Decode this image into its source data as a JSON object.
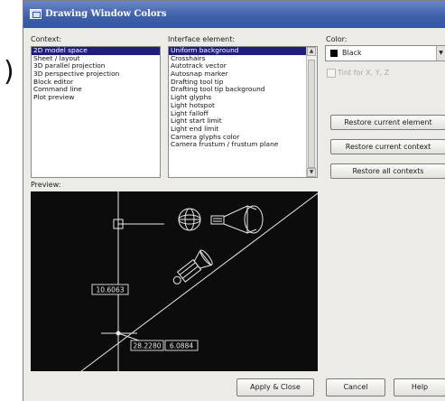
{
  "external_text": ")",
  "window": {
    "title": "Drawing Window Colors"
  },
  "context": {
    "label": "Context:",
    "items": [
      {
        "label": "2D model space",
        "selected": true
      },
      {
        "label": "Sheet / layout",
        "selected": false
      },
      {
        "label": "3D parallel projection",
        "selected": false
      },
      {
        "label": "3D perspective projection",
        "selected": false
      },
      {
        "label": "Block editor",
        "selected": false
      },
      {
        "label": "Command line",
        "selected": false
      },
      {
        "label": "Plot preview",
        "selected": false
      }
    ]
  },
  "interface": {
    "label": "Interface element:",
    "items": [
      {
        "label": "Uniform background",
        "selected": true
      },
      {
        "label": "Crosshairs",
        "selected": false
      },
      {
        "label": "Autotrack vector",
        "selected": false
      },
      {
        "label": "Autosnap marker",
        "selected": false
      },
      {
        "label": "Drafting tool tip",
        "selected": false
      },
      {
        "label": "Drafting tool tip background",
        "selected": false
      },
      {
        "label": "Light glyphs",
        "selected": false
      },
      {
        "label": "Light hotspot",
        "selected": false
      },
      {
        "label": "Light falloff",
        "selected": false
      },
      {
        "label": "Light start limit",
        "selected": false
      },
      {
        "label": "Light end limit",
        "selected": false
      },
      {
        "label": "Camera glyphs color",
        "selected": false
      },
      {
        "label": "Camera frustum / frustum plane",
        "selected": false
      }
    ]
  },
  "color": {
    "label": "Color:",
    "value": "Black",
    "swatch": "#000000",
    "tint_label": "Tint for X, Y, Z",
    "tint_checked": false
  },
  "buttons": {
    "restore_element": "Restore current element",
    "restore_context": "Restore current context",
    "restore_all": "Restore all contexts",
    "apply": "Apply & Close",
    "cancel": "Cancel",
    "help": "Help"
  },
  "preview": {
    "label": "Preview:",
    "dim1": "10.6063",
    "dim2": "28.2280",
    "dim3": "6.0884"
  },
  "colors": {
    "title_bar": "#3d5ea8",
    "selection": "#1f1f7a",
    "preview_bg": "#0c0c0c",
    "preview_lines": "#e8e8e8"
  }
}
